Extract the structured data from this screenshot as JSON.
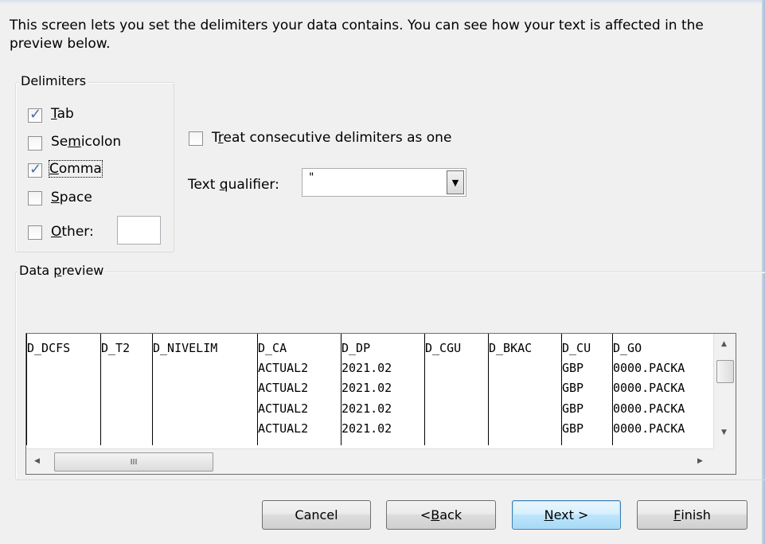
{
  "intro": "This screen lets you set the delimiters your data contains.  You can see how your text is affected in the preview below.",
  "delimiters": {
    "title": "Delimiters",
    "tab": {
      "label": "Tab",
      "checked": true
    },
    "semicolon": {
      "label": "Semicolon",
      "checked": false
    },
    "comma": {
      "label": "Comma",
      "checked": true
    },
    "space": {
      "label": "Space",
      "checked": false
    },
    "other": {
      "label": "Other:",
      "checked": false,
      "value": ""
    }
  },
  "consecutive": {
    "label": "Treat consecutive delimiters as one",
    "checked": false
  },
  "qualifier": {
    "label": "Text qualifier:",
    "value": "\""
  },
  "preview": {
    "title": "Data preview",
    "columns": [
      "D_DCFS",
      "D_T2",
      "D_NIVELIM",
      "D_CA",
      "D_DP",
      "D_CGU",
      "D_BKAC",
      "D_CU",
      "D_GO"
    ],
    "rows": [
      [
        "",
        "",
        "",
        "ACTUAL2",
        "2021.02",
        "",
        "",
        "GBP",
        "0000.PACKA"
      ],
      [
        "",
        "",
        "",
        "ACTUAL2",
        "2021.02",
        "",
        "",
        "GBP",
        "0000.PACKA"
      ],
      [
        "",
        "",
        "",
        "ACTUAL2",
        "2021.02",
        "",
        "",
        "GBP",
        "0000.PACKA"
      ],
      [
        "",
        "",
        "",
        "ACTUAL2",
        "2021.02",
        "",
        "",
        "GBP",
        "0000.PACKA"
      ]
    ]
  },
  "scroll": {
    "up_arrow": "▲",
    "down_arrow": "▼",
    "left_arrow": "◀",
    "right_arrow": "▶",
    "grip": "III"
  },
  "buttons": {
    "cancel": "Cancel",
    "back": "< Back",
    "next": "Next >",
    "finish": "Finish"
  }
}
